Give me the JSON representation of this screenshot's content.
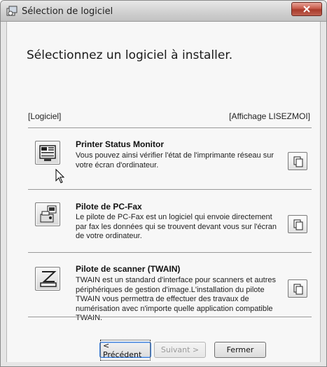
{
  "window": {
    "title": "Sélection de logiciel",
    "icon": "installer-app-icon",
    "close_icon": "close-x-icon"
  },
  "main": {
    "heading": "Sélectionnez un logiciel à installer.",
    "column_left": "[Logiciel]",
    "column_right": "[Affichage LISEZMOI]"
  },
  "items": [
    {
      "title": "Printer Status Monitor",
      "description": "Vous pouvez ainsi vérifier l'état de l'imprimante réseau sur votre écran d'ordinateur.",
      "icon": "printer-status-monitor-icon",
      "readme_icon": "document-copy-icon"
    },
    {
      "title": "Pilote de PC-Fax",
      "description": "Le pilote de PC-Fax est un logiciel qui envoie directement par fax les données qui se trouvent devant vous sur l'écran de votre ordinateur.",
      "icon": "pc-fax-icon",
      "readme_icon": "document-copy-icon"
    },
    {
      "title": "Pilote de scanner (TWAIN)",
      "description": "TWAIN est un standard d'interface pour scanners et autres périphériques de gestion d'image.L'installation du pilote TWAIN vous permettra de effectuer des travaux de numérisation avec n'importe quelle application compatible TWAIN.",
      "icon": "scanner-icon",
      "readme_icon": "document-copy-icon"
    }
  ],
  "footer": {
    "back_label": "< Précédent",
    "next_label": "Suivant >",
    "close_label": "Fermer"
  }
}
